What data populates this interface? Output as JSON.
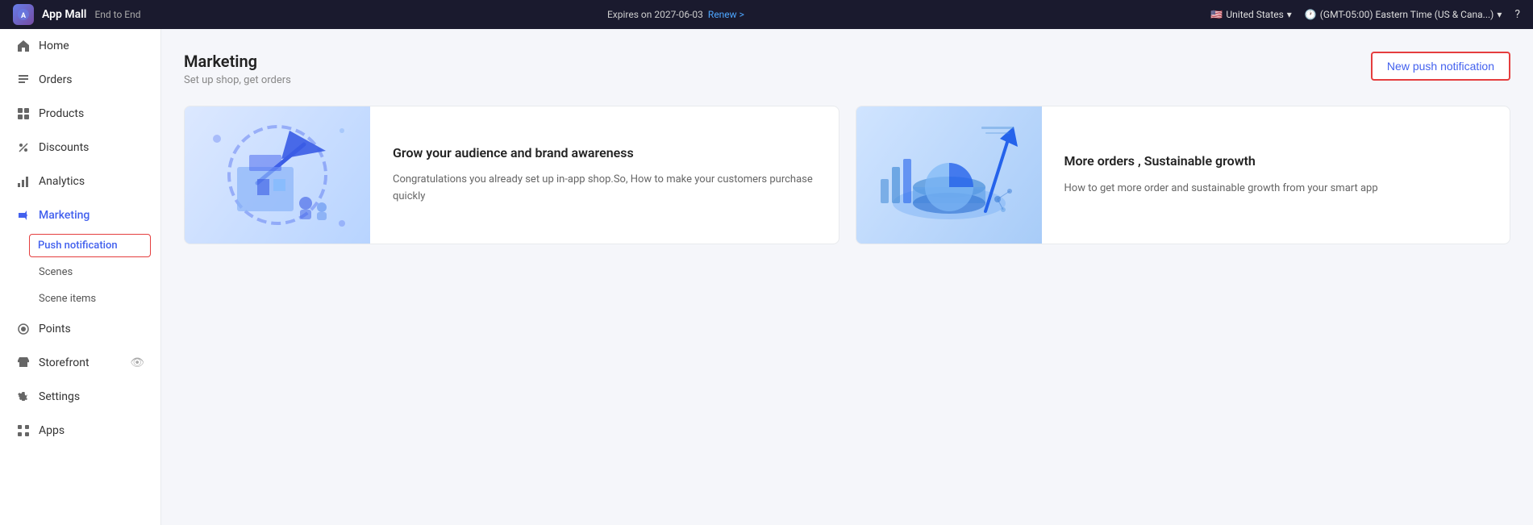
{
  "topbar": {
    "logo_text": "AM",
    "app_name": "App Mall",
    "app_subtitle": "End to End",
    "expires_label": "Expires on 2027-06-03",
    "renew_label": "Renew >",
    "country": "United States",
    "timezone": "(GMT-05:00) Eastern Time (US & Cana...)",
    "help_icon": "?"
  },
  "sidebar": {
    "items": [
      {
        "id": "home",
        "label": "Home",
        "icon": "home"
      },
      {
        "id": "orders",
        "label": "Orders",
        "icon": "orders"
      },
      {
        "id": "products",
        "label": "Products",
        "icon": "products"
      },
      {
        "id": "discounts",
        "label": "Discounts",
        "icon": "discounts"
      },
      {
        "id": "analytics",
        "label": "Analytics",
        "icon": "analytics"
      },
      {
        "id": "marketing",
        "label": "Marketing",
        "icon": "marketing",
        "active": true
      }
    ],
    "sub_items": [
      {
        "id": "push-notification",
        "label": "Push notification",
        "active": true
      },
      {
        "id": "scenes",
        "label": "Scenes"
      },
      {
        "id": "scene-items",
        "label": "Scene items"
      }
    ],
    "bottom_items": [
      {
        "id": "points",
        "label": "Points",
        "icon": "points"
      },
      {
        "id": "storefront",
        "label": "Storefront",
        "icon": "storefront",
        "has_eye": true
      },
      {
        "id": "settings",
        "label": "Settings",
        "icon": "settings"
      },
      {
        "id": "apps",
        "label": "Apps",
        "icon": "apps"
      }
    ]
  },
  "main": {
    "page_title": "Marketing",
    "page_subtitle": "Set up shop, get orders",
    "new_push_button_label": "New push notification",
    "cards": [
      {
        "id": "card-audience",
        "title": "Grow your audience and brand awareness",
        "description": "Congratulations you already set up in-app shop.So, How to make your customers purchase quickly"
      },
      {
        "id": "card-growth",
        "title": "More orders , Sustainable growth",
        "description": "How to get more order and sustainable growth from your smart app"
      }
    ]
  }
}
